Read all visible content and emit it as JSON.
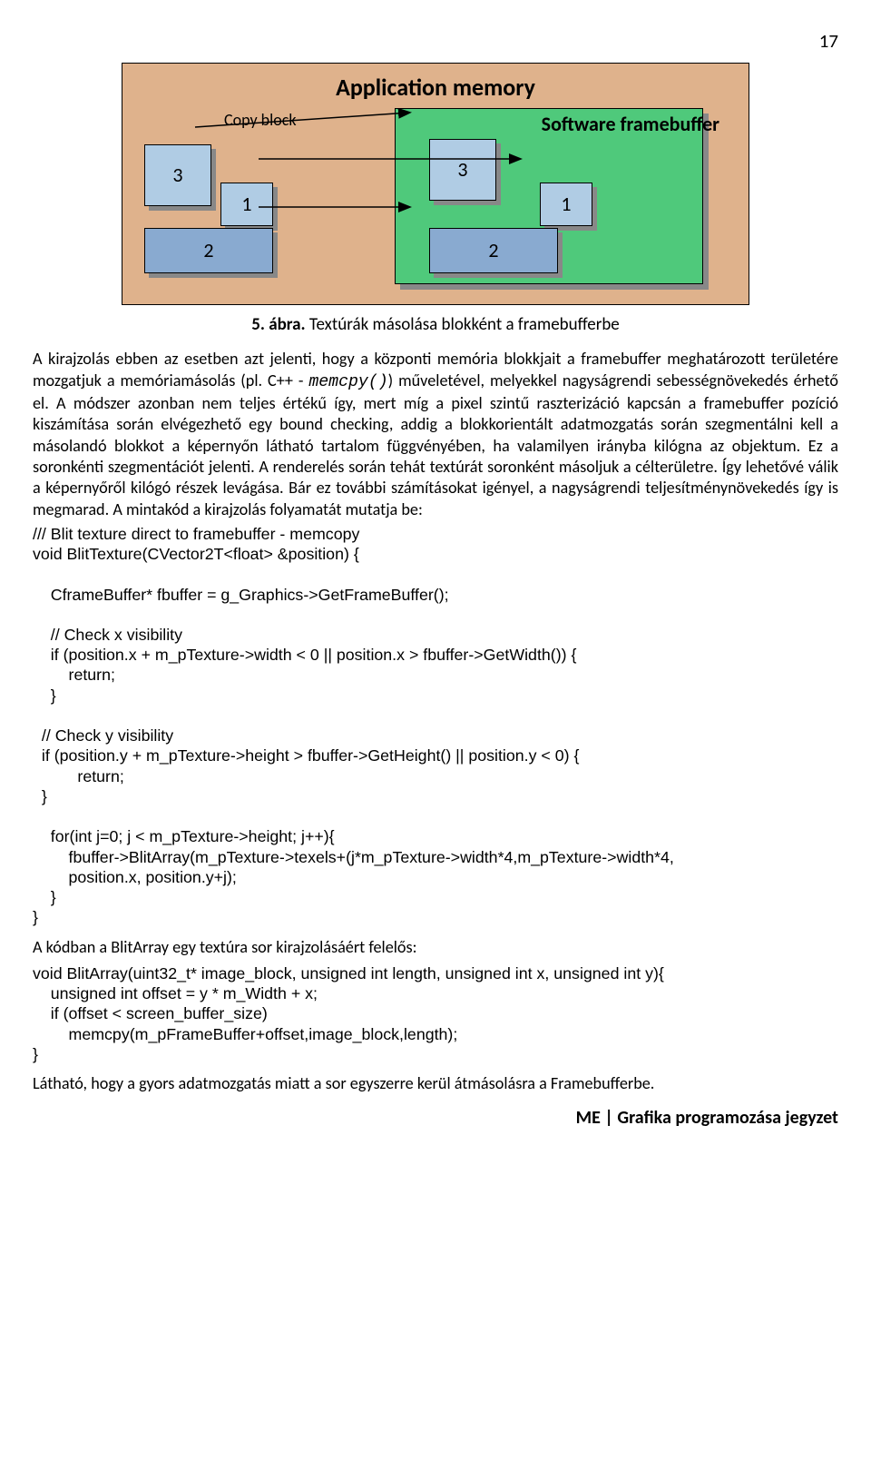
{
  "page_number": "17",
  "diagram": {
    "title": "Application memory",
    "copy_label": "Copy block",
    "fb_title": "Software framebuffer",
    "blocks": {
      "b3": "3",
      "b1": "1",
      "b2": "2"
    }
  },
  "caption_num": "5. ábra.",
  "caption_text": " Textúrák másolása blokként a framebufferbe",
  "para_part1": "A kirajzolás ebben az esetben azt jelenti, hogy a központi memória blokkjait a framebuffer meghatározott területére mozgatjuk a memóriamásolás (pl. C++ - ",
  "memcpy": "memcpy()",
  "para_part2": ") műveletével, melyekkel nagyságrendi sebességnövekedés érhető el. A módszer azonban nem teljes értékű így, mert míg a pixel szintű raszterizáció kapcsán a framebuffer pozíció kiszámítása során elvégezhető egy bound checking, addig a blokkorientált adatmozgatás során szegmentálni kell a másolandó blokkot a képernyőn látható tartalom függvényében, ha valamilyen irányba kilógna az objektum. Ez a soronkénti szegmentációt jelenti. A renderelés során tehát textúrát soronként másoljuk a célterületre. Így lehetővé válik a képernyőről kilógó részek levágása. Bár ez további számításokat igényel, a nagyságrendi teljesítménynövekedés így is megmarad. A mintakód a kirajzolás folyamatát mutatja be:",
  "code1": "/// Blit texture direct to framebuffer - memcopy\nvoid BlitTexture(CVector2T<float> &position) {\n\n    CframeBuffer* fbuffer = g_Graphics->GetFrameBuffer();\n\n    // Check x visibility\n    if (position.x + m_pTexture->width < 0 || position.x > fbuffer->GetWidth()) {\n        return;\n    }\n\n  // Check y visibility\n  if (position.y + m_pTexture->height > fbuffer->GetHeight() || position.y < 0) {\n          return;\n  }\n\n    for(int j=0; j < m_pTexture->height; j++){\n        fbuffer->BlitArray(m_pTexture->texels+(j*m_pTexture->width*4,m_pTexture->width*4,\n        position.x, position.y+j);\n    }\n}",
  "mid_text": "A kódban a BlitArray egy textúra sor kirajzolásáért felelős:",
  "code2": "void BlitArray(uint32_t* image_block, unsigned int length, unsigned int x, unsigned int y){\n    unsigned int offset = y * m_Width + x;\n    if (offset < screen_buffer_size)\n        memcpy(m_pFrameBuffer+offset,image_block,length);\n}",
  "foot_text": "Látható, hogy a gyors adatmozgatás miatt a sor egyszerre kerül átmásolásra a Framebufferbe.",
  "footer": "ME | Grafika programozása jegyzet"
}
